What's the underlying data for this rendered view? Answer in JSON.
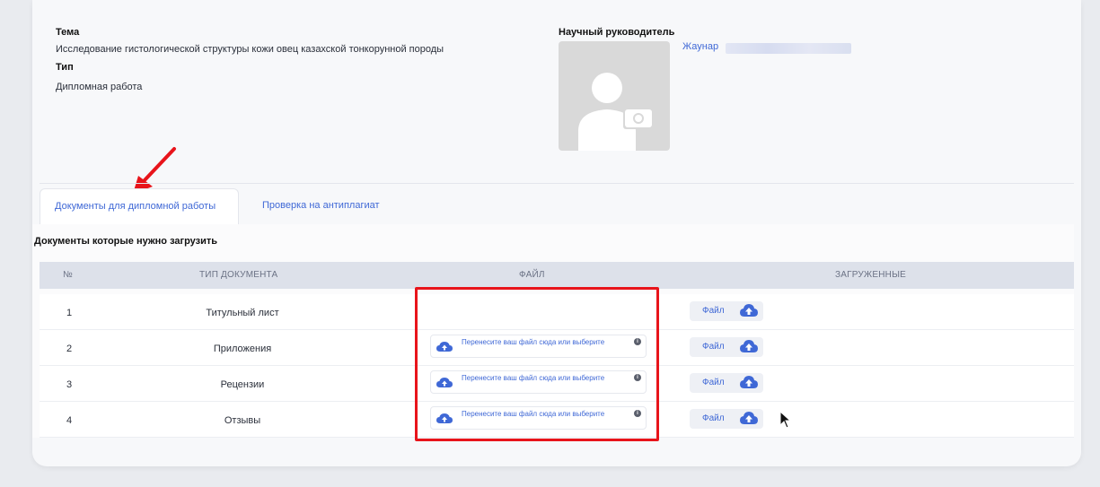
{
  "thesis": {
    "topic_label": "Тема",
    "topic_value": "Исследование гистологической структуры кожи овец казахской тонкорунной породы",
    "type_label": "Тип",
    "type_value": "Дипломная работа"
  },
  "supervisor": {
    "label": "Научный руководитель",
    "name": "Жаунар"
  },
  "tabs": [
    {
      "label": "Документы для дипломной работы",
      "active": true
    },
    {
      "label": "Проверка на антиплагиат",
      "active": false
    }
  ],
  "section_title": "Документы которые нужно загрузить",
  "table": {
    "headers": {
      "num": "№",
      "type": "ТИП ДОКУМЕНТА",
      "file": "ФАЙЛ",
      "uploaded": "ЗАГРУЖЕННЫЕ"
    },
    "rows": [
      {
        "num": "1",
        "type": "Титульный лист",
        "has_drop": false
      },
      {
        "num": "2",
        "type": "Приложения",
        "has_drop": true
      },
      {
        "num": "3",
        "type": "Рецензии",
        "has_drop": true
      },
      {
        "num": "4",
        "type": "Отзывы",
        "has_drop": true
      }
    ],
    "drop_text": "Перенесите ваш файл сюда или выберите",
    "file_button_label": "Файл"
  },
  "colors": {
    "accent": "#3f68d6",
    "highlight": "#e8141b"
  }
}
